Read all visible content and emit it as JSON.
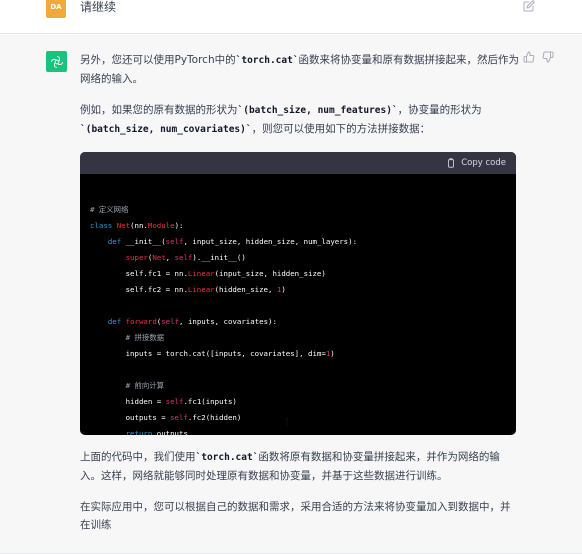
{
  "user": {
    "avatar_initials": "DA",
    "message": "请继续"
  },
  "assistant": {
    "para1": [
      "另外，您还可以使用PyTorch中的",
      "`torch.cat`",
      "函数来将协变量和原有数据拼接起来，然后作为网络的输入。"
    ],
    "para2": [
      "例如，如果您的原有数据的形状为",
      "`(batch_size, num_features)`",
      "，协变量的形状为",
      "`(batch_size, num_covariates)`",
      "，则您可以使用如下的方法拼接数据："
    ],
    "code_header": {
      "copy_label": "Copy code"
    },
    "code_lines": [
      "",
      "# 定义网络",
      "class Net(nn.Module):",
      "    def __init__(self, input_size, hidden_size, num_layers):",
      "        super(Net, self).__init__()",
      "        self.fc1 = nn.Linear(input_size, hidden_size)",
      "        self.fc2 = nn.Linear(hidden_size, 1)",
      "",
      "    def forward(self, inputs, covariates):",
      "        # 拼接数据",
      "        inputs = torch.cat([inputs, covariates], dim=1)",
      "",
      "        # 前向计算",
      "        hidden = self.fc1(inputs)",
      "        outputs = self.fc2(hidden)",
      "        return outputs"
    ],
    "para3": [
      "上面的代码中，我们使用",
      "`torch.cat`",
      "函数将原有数据和协变量拼接起来，并作为网络的输入。这样，网络就能够同时处理原有数据和协变量，并基于这些数据进行训练。"
    ],
    "para4": "在实际应用中，您可以根据自己的数据和需求，采用合适的方法来将协变量加入到数据中，并在训练"
  },
  "icons": {
    "edit": "pencil-edit-icon",
    "thumbs_up": "thumbs-up-icon",
    "thumbs_down": "thumbs-down-icon",
    "clipboard": "clipboard-icon",
    "logo": "openai-logo-icon"
  },
  "colors": {
    "user_avatar": "#f2a93b",
    "gpt_avatar": "#19c37d",
    "assistant_bg": "#f7f7f8",
    "code_bg": "#000000",
    "code_header_bg": "#343541"
  }
}
